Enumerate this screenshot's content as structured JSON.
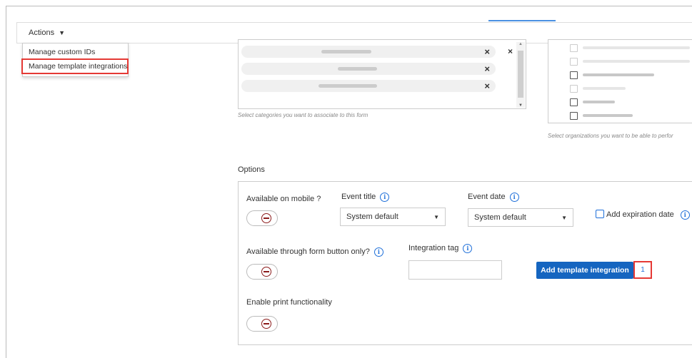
{
  "actions_bar": {
    "label": "Actions",
    "caret": "▼"
  },
  "actions_menu": {
    "items": [
      {
        "label": "Manage custom IDs"
      },
      {
        "label": "Manage template integrations"
      }
    ]
  },
  "categories": {
    "chips": [
      {
        "remove_icon": "×"
      },
      {
        "remove_icon": "×"
      },
      {
        "remove_icon": "×"
      }
    ],
    "clear_icon": "×",
    "hint": "Select categories you want to associate to this form"
  },
  "organizations": {
    "hint": "Select organizations you want to be able to perfor"
  },
  "options": {
    "title": "Options",
    "available_on_mobile": {
      "label": "Available on mobile ?",
      "state": "off"
    },
    "event_title": {
      "label": "Event title",
      "value": "System default"
    },
    "event_date": {
      "label": "Event date",
      "value": "System default"
    },
    "add_expiration_date": {
      "label": "Add expiration date",
      "checked": false
    },
    "form_button_only": {
      "label": "Available through form button only?",
      "state": "off"
    },
    "integration_tag": {
      "label": "Integration tag",
      "value": ""
    },
    "add_integration_button": {
      "label": "Add template integration",
      "count": "1"
    },
    "print": {
      "label": "Enable print functionality",
      "state": "off"
    }
  },
  "icons": {
    "info": "i",
    "dropdown_arrow": "▼"
  },
  "colors": {
    "primary": "#1565c0",
    "highlight": "#e53935",
    "info": "#1e6fd9",
    "toggle_off": "#8b1a1a"
  }
}
